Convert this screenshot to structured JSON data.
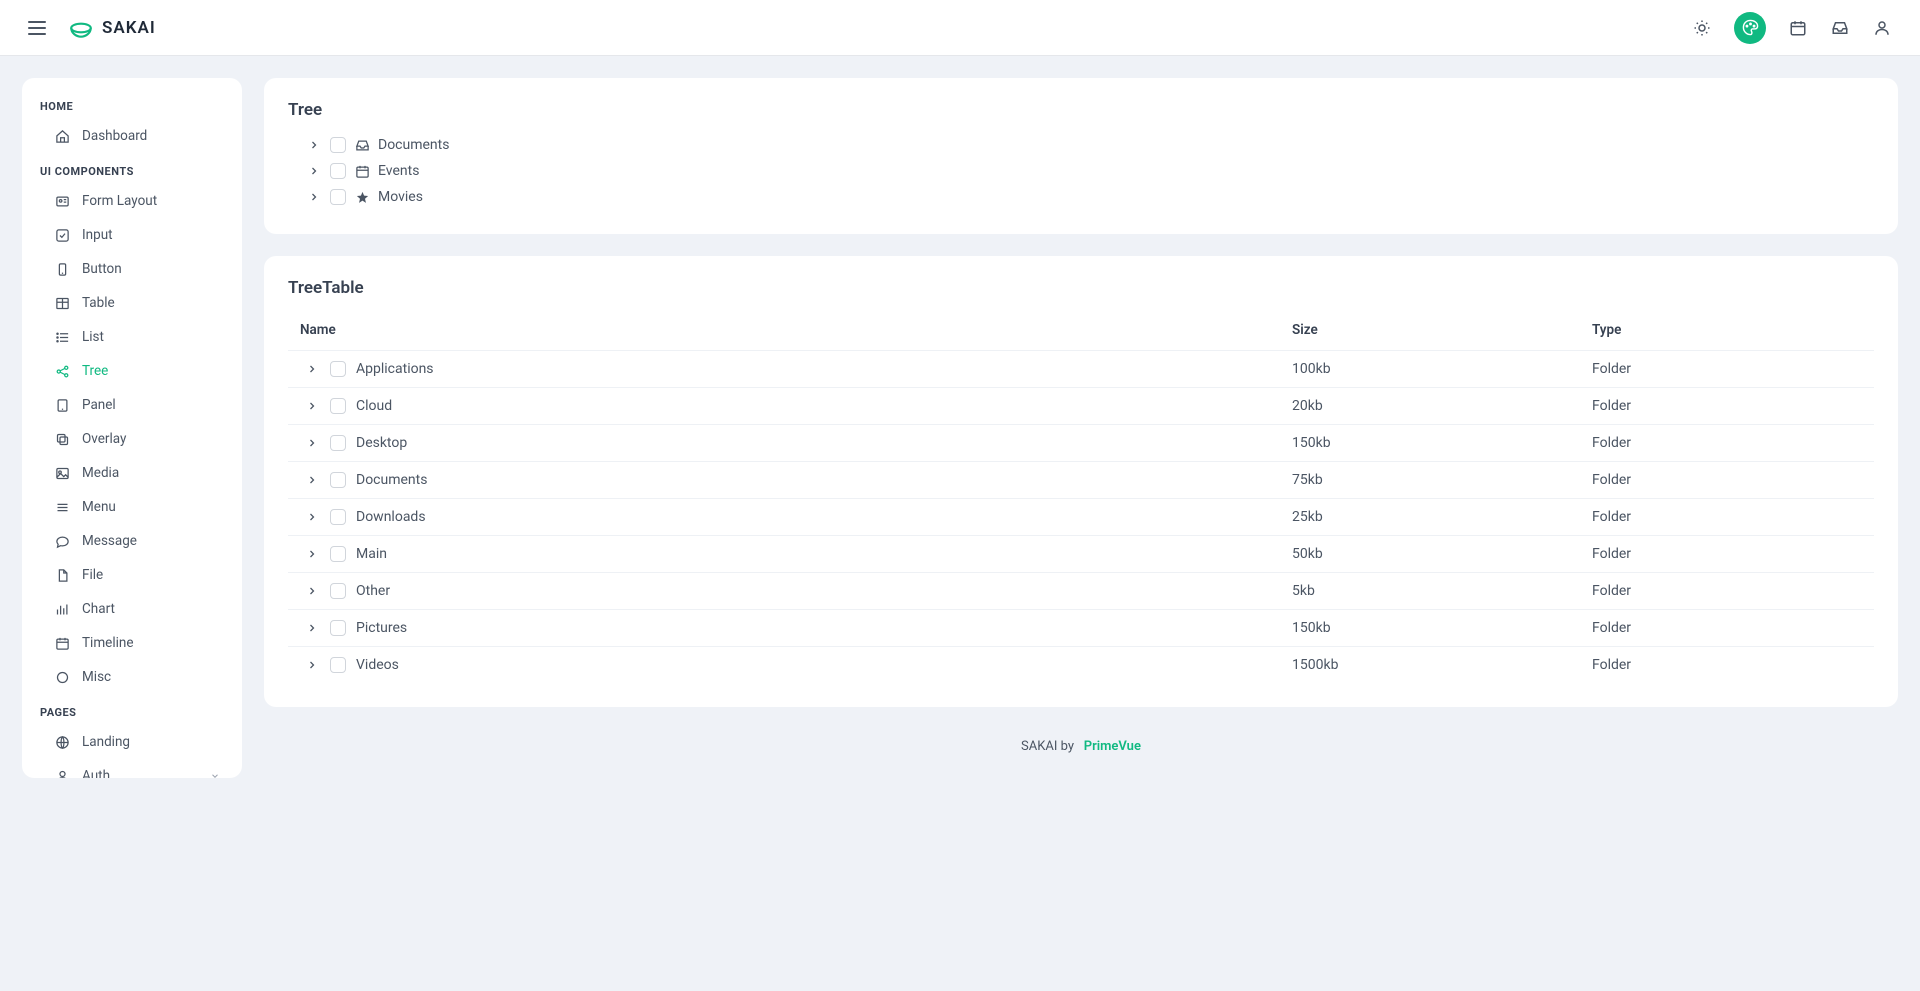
{
  "topbar": {
    "brand": "SAKAI"
  },
  "sidebar": {
    "sections": [
      {
        "title": "HOME",
        "items": [
          {
            "label": "Dashboard",
            "icon": "home"
          }
        ]
      },
      {
        "title": "UI COMPONENTS",
        "items": [
          {
            "label": "Form Layout",
            "icon": "id-card"
          },
          {
            "label": "Input",
            "icon": "check-square"
          },
          {
            "label": "Button",
            "icon": "mobile"
          },
          {
            "label": "Table",
            "icon": "table"
          },
          {
            "label": "List",
            "icon": "list"
          },
          {
            "label": "Tree",
            "icon": "share",
            "active": true
          },
          {
            "label": "Panel",
            "icon": "tablet"
          },
          {
            "label": "Overlay",
            "icon": "clone"
          },
          {
            "label": "Media",
            "icon": "image"
          },
          {
            "label": "Menu",
            "icon": "bars"
          },
          {
            "label": "Message",
            "icon": "comment"
          },
          {
            "label": "File",
            "icon": "file"
          },
          {
            "label": "Chart",
            "icon": "chart-bar"
          },
          {
            "label": "Timeline",
            "icon": "calendar"
          },
          {
            "label": "Misc",
            "icon": "circle"
          }
        ]
      },
      {
        "title": "PAGES",
        "items": [
          {
            "label": "Landing",
            "icon": "globe"
          },
          {
            "label": "Auth",
            "icon": "user",
            "expandable": true
          }
        ]
      }
    ]
  },
  "treeCard": {
    "title": "Tree",
    "nodes": [
      {
        "label": "Documents",
        "icon": "inbox"
      },
      {
        "label": "Events",
        "icon": "calendar"
      },
      {
        "label": "Movies",
        "icon": "star"
      }
    ]
  },
  "treeTableCard": {
    "title": "TreeTable",
    "columns": {
      "name": "Name",
      "size": "Size",
      "type": "Type"
    },
    "rows": [
      {
        "name": "Applications",
        "size": "100kb",
        "type": "Folder"
      },
      {
        "name": "Cloud",
        "size": "20kb",
        "type": "Folder"
      },
      {
        "name": "Desktop",
        "size": "150kb",
        "type": "Folder"
      },
      {
        "name": "Documents",
        "size": "75kb",
        "type": "Folder"
      },
      {
        "name": "Downloads",
        "size": "25kb",
        "type": "Folder"
      },
      {
        "name": "Main",
        "size": "50kb",
        "type": "Folder"
      },
      {
        "name": "Other",
        "size": "5kb",
        "type": "Folder"
      },
      {
        "name": "Pictures",
        "size": "150kb",
        "type": "Folder"
      },
      {
        "name": "Videos",
        "size": "1500kb",
        "type": "Folder"
      }
    ]
  },
  "footer": {
    "text": "SAKAI by",
    "brand": "PrimeVue"
  }
}
